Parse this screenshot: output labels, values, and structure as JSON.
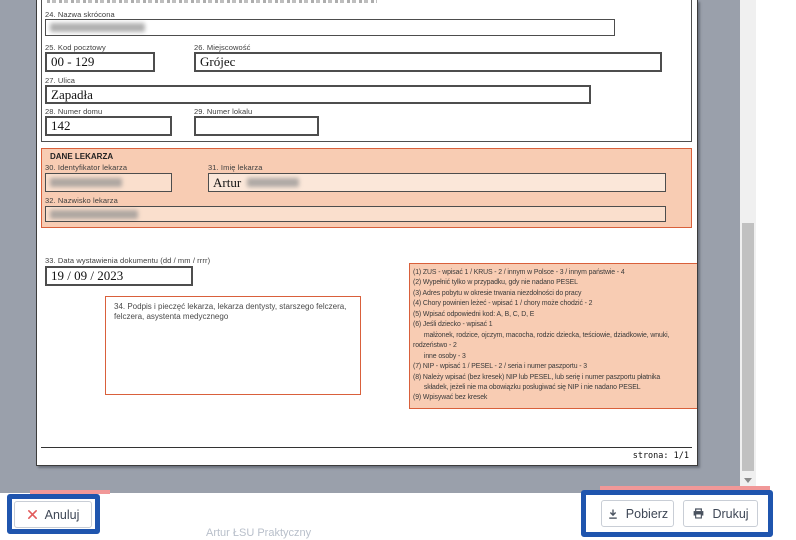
{
  "document": {
    "payer": {
      "f24": {
        "label": "24. Nazwa skrócona",
        "value": ""
      },
      "f25": {
        "label": "25. Kod pocztowy",
        "value": "00 - 129"
      },
      "f26": {
        "label": "26. Miejscowość",
        "value": "Grójec"
      },
      "f27": {
        "label": "27. Ulica",
        "value": "Zapadła"
      },
      "f28": {
        "label": "28. Numer domu",
        "value": "142"
      },
      "f29": {
        "label": "29. Numer lokalu",
        "value": ""
      }
    },
    "doctor": {
      "title": "DANE LEKARZA",
      "f30": {
        "label": "30. Identyfikator lekarza",
        "value": ""
      },
      "f31": {
        "label": "31. Imię lekarza",
        "value": "Artur"
      },
      "f32": {
        "label": "32. Nazwisko lekarza",
        "value": ""
      }
    },
    "issue_date": {
      "label": "33. Data wystawienia dokumentu (dd / mm / rrrr)",
      "value": "19 / 09 / 2023"
    },
    "signature": {
      "label": "34. Podpis i pieczęć lekarza, lekarza dentysty, starszego felczera, felczera, asystenta medycznego"
    },
    "footnotes": [
      "(1) ZUS - wpisać 1 / KRUS - 2 / innym w Polsce - 3 / innym państwie - 4",
      "(2) Wypełnić tylko w przypadku, gdy nie nadano PESEL",
      "(3) Adres pobytu w okresie trwania niezdolności do pracy",
      "(4) Chory powinien leżeć - wpisać 1 / chory może chodzić - 2",
      "(5) Wpisać odpowiedni kod: A, B, C, D, E",
      "(6) Jeśli dziecko - wpisać 1",
      "      małżonek, rodzice, ojczym, macocha, rodzic dziecka, teściowie, dziadkowie, wnuki,",
      "rodzeństwo - 2",
      "      inne osoby - 3",
      "(7) NIP - wpisać 1 / PESEL - 2 / seria i numer paszportu - 3",
      "(8) Należy wpisać (bez kresek) NIP lub PESEL, lub serię i numer paszportu płatnika",
      "      składek, jeżeli nie ma obowiązku posługiwać się NIP i nie nadano PESEL",
      "(9) Wpisywać bez kresek"
    ],
    "page_indicator": "strona: 1/1"
  },
  "footer": {
    "cancel_label": "Anuluj",
    "download_label": "Pobierz",
    "print_label": "Drukuj",
    "watermark": "Artur ŁSU Praktyczny"
  },
  "colors": {
    "annotation_blue": "#1f55ae",
    "annotation_pink": "#f19898",
    "section_fill": "#f8ccb3",
    "section_border": "#d9603b",
    "viewer_background": "#9aa0ab",
    "cancel_x_red": "#e25b5b",
    "scrollbar_thumb": "#c1c1c1"
  }
}
